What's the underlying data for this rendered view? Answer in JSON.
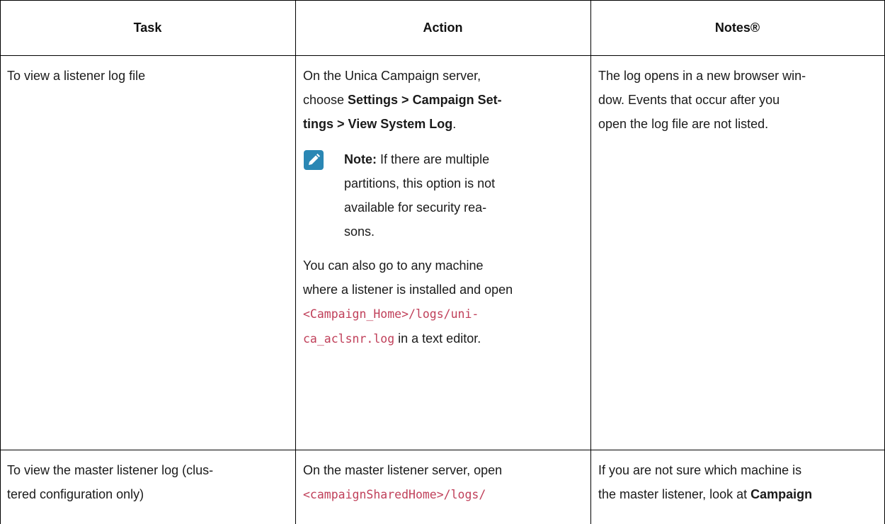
{
  "table": {
    "headers": [
      "Task",
      "Action",
      "Notes®"
    ],
    "rows": [
      {
        "task": [
          "To view a listener log file"
        ],
        "action": {
          "intro": [
            "On the Unica Campaign server,"
          ],
          "intro_line2_prefix": "choose ",
          "intro_line2_bold": "Settings >  Campaign Set-",
          "intro_line3_bold": "tings >  View System Log",
          "intro_line3_suffix": ".",
          "note_label": "Note:",
          "note_line1": " If there are multiple",
          "note_lines": [
            "partitions, this option is not",
            "available for security rea-",
            "sons."
          ],
          "also_lines": [
            "You can also go to any machine",
            "where a listener is installed and open"
          ],
          "code_line1": "<Campaign_Home>/logs/uni-",
          "code_line2": "ca_aclsnr.log",
          "code_suffix": " in a text editor."
        },
        "notes": [
          "The log opens in a new browser win-",
          "dow. Events that occur after you",
          "open the log file are not listed."
        ]
      },
      {
        "task": [
          "To view the master listener log (clus-",
          "tered configuration only)"
        ],
        "action": {
          "line1": "On the master listener server, open",
          "code_line1": "<campaignSharedHome>/logs/"
        },
        "notes": {
          "line1": "If you are not sure which machine is",
          "line2_prefix": "the master listener, look at ",
          "line2_bold": "Campaign"
        }
      }
    ]
  },
  "icons": {
    "note": "pencil-icon"
  },
  "colors": {
    "code": "#c0405a",
    "note_icon_bg": "#2a87b4"
  }
}
